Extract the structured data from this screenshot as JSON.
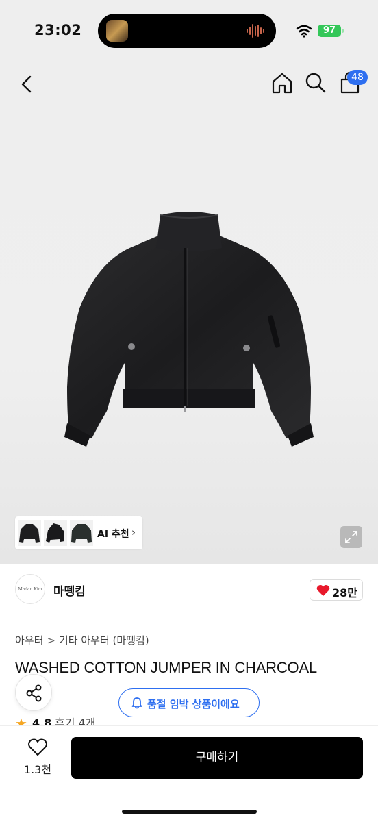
{
  "status_bar": {
    "time": "23:02",
    "battery": "97",
    "icons": [
      "now-playing-artwork",
      "waveform-icon",
      "wifi-icon",
      "battery-charging-icon"
    ]
  },
  "header": {
    "icons": [
      "back-chevron-icon",
      "home-icon",
      "search-icon",
      "shopping-bag-icon"
    ],
    "cart_count": "48"
  },
  "gallery": {
    "ai_recommend_label": "AI 추천",
    "ai_chevron": "›",
    "thumbnails": [
      "jacket-front",
      "jacket-side",
      "jacket-dark"
    ]
  },
  "seller": {
    "logo_text": "Madan Kim",
    "name": "마뗑킴",
    "like_count": "28만"
  },
  "breadcrumb": {
    "level1": "아우터",
    "separator": ">",
    "level2": "기타 아우터 (마뗑킴)"
  },
  "product": {
    "title": "WASHED COTTON JUMPER IN CHARCOAL",
    "rating_star": "★",
    "rating": "4.8",
    "reviews": "후기 4개"
  },
  "notice": {
    "soldout_soon": "품절 임박 상품이에요"
  },
  "bottom_bar": {
    "wish_count": "1.3천",
    "buy_label": "구매하기"
  },
  "colors": {
    "accent_blue": "#2e6ff0",
    "heart_red": "#e8192c",
    "battery_green": "#34c759",
    "buy_button": "#000000"
  }
}
